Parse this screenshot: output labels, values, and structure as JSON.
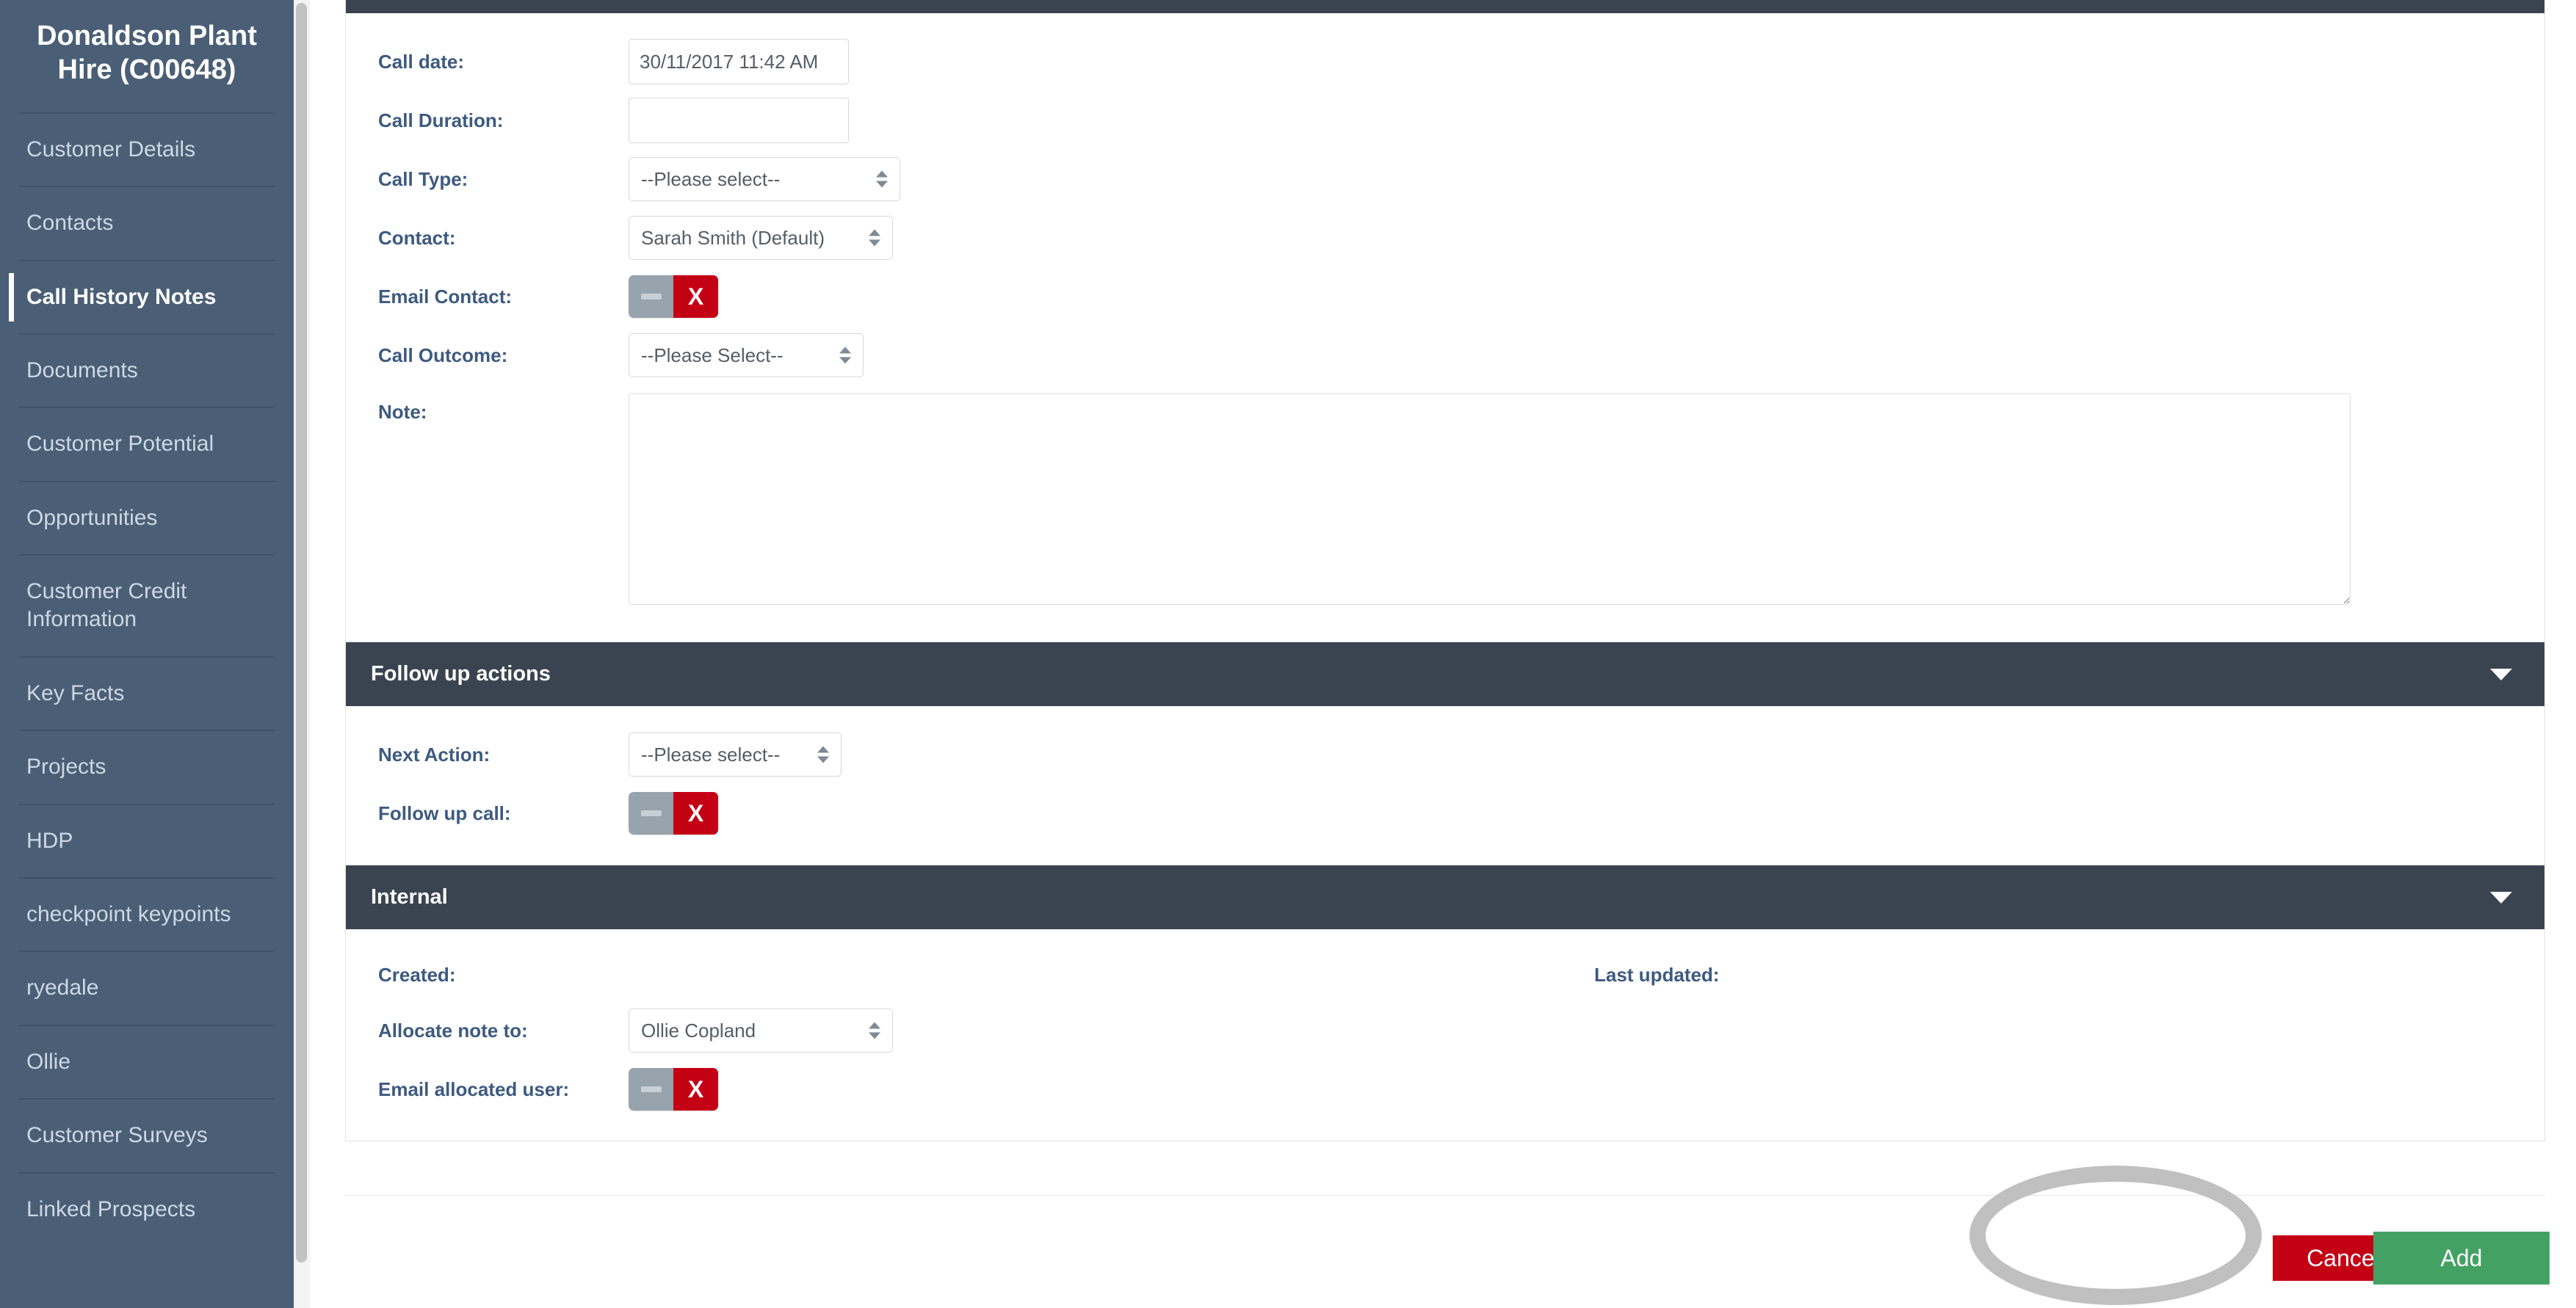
{
  "sidebar": {
    "brand": "Donaldson Plant Hire (C00648)",
    "items": [
      {
        "label": "Customer Details",
        "active": false
      },
      {
        "label": "Contacts",
        "active": false
      },
      {
        "label": "Call History Notes",
        "active": true
      },
      {
        "label": "Documents",
        "active": false
      },
      {
        "label": "Customer Potential",
        "active": false
      },
      {
        "label": "Opportunities",
        "active": false
      },
      {
        "label": "Customer Credit Information",
        "active": false
      },
      {
        "label": "Key Facts",
        "active": false
      },
      {
        "label": "Projects",
        "active": false
      },
      {
        "label": "HDP",
        "active": false
      },
      {
        "label": "checkpoint keypoints",
        "active": false
      },
      {
        "label": "ryedale",
        "active": false
      },
      {
        "label": "Ollie",
        "active": false
      },
      {
        "label": "Customer Surveys",
        "active": false
      },
      {
        "label": "Linked Prospects",
        "active": false
      }
    ]
  },
  "call_details": {
    "call_date": {
      "label": "Call date:",
      "value": "30/11/2017 11:42 AM",
      "placeholder": ""
    },
    "call_duration": {
      "label": "Call Duration:",
      "value": "",
      "placeholder": ""
    },
    "call_type": {
      "label": "Call Type:",
      "value": "--Please select--"
    },
    "contact": {
      "label": "Contact:",
      "value": "Sarah Smith (Default)"
    },
    "email_contact": {
      "label": "Email Contact:",
      "off_icon": "minus-icon",
      "on_icon": "X"
    },
    "call_outcome": {
      "label": "Call Outcome:",
      "value": "--Please Select--"
    },
    "note": {
      "label": "Note:",
      "value": "",
      "placeholder": ""
    }
  },
  "follow_up": {
    "header": "Follow up actions",
    "collapse_icon": "chevron-down-icon",
    "next_action": {
      "label": "Next Action:",
      "value": "--Please select--"
    },
    "follow_up_call": {
      "label": "Follow up call:",
      "off_icon": "minus-icon",
      "on_icon": "X"
    }
  },
  "internal": {
    "header": "Internal",
    "collapse_icon": "chevron-down-icon",
    "created": {
      "label": "Created:",
      "value": ""
    },
    "last_updated": {
      "label": "Last updated:",
      "value": ""
    },
    "allocate_note_to": {
      "label": "Allocate note to:",
      "value": "Ollie Copland"
    },
    "email_allocated_user": {
      "label": "Email allocated user:",
      "off_icon": "minus-icon",
      "on_icon": "X"
    }
  },
  "actions": {
    "cancel_label": "Cancel",
    "add_label": "Add"
  },
  "colors": {
    "sidebar": "#4a5f76",
    "section_header": "#3a4450",
    "label_text": "#3d5a80",
    "toggle_on": "#c40014",
    "toggle_off": "#97a3ad",
    "cancel": "#c40014",
    "add": "#43a263",
    "highlight": "#c0c0c0"
  }
}
